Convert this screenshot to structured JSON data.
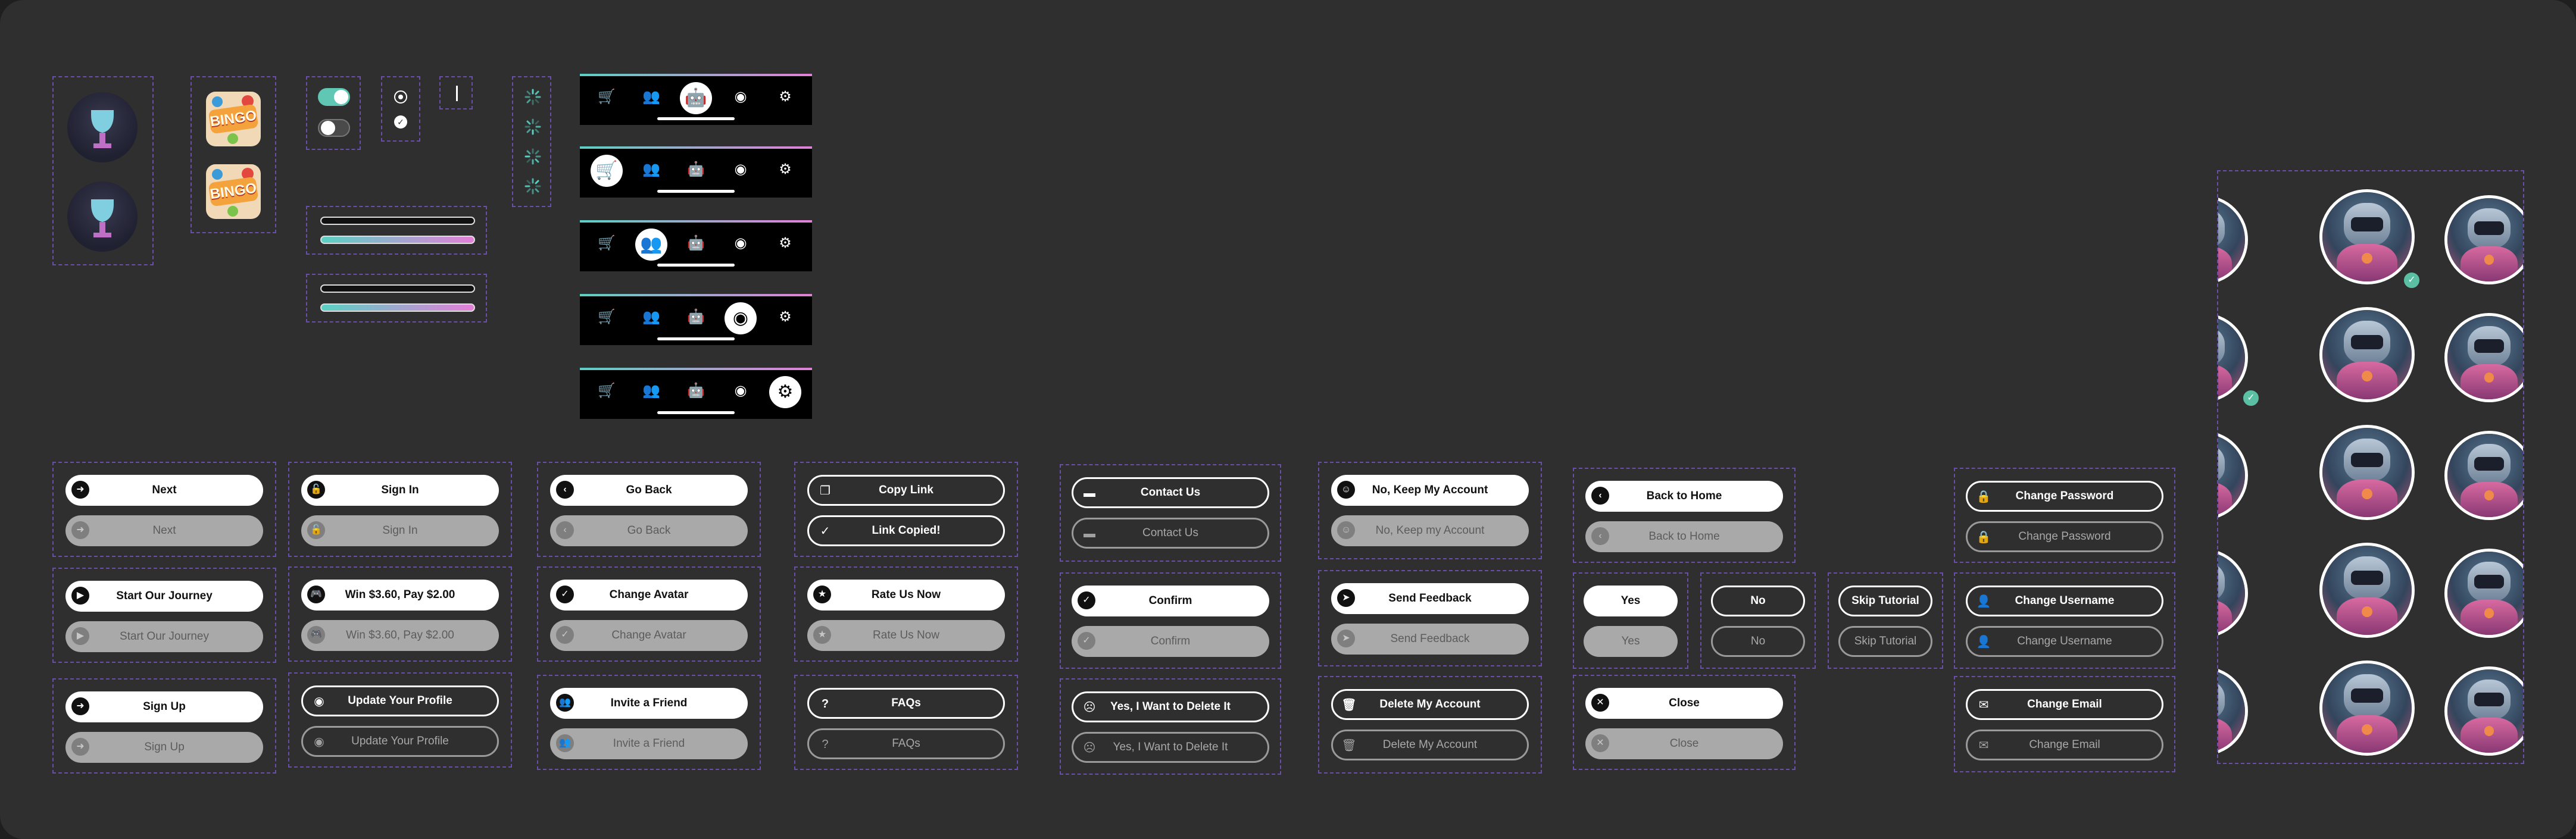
{
  "colors": {
    "background": "#2f2f2f",
    "group_border": "#6a4fa8",
    "accent_teal": "#5ad1c4",
    "accent_pink": "#e47fd8",
    "button_white": "#ffffff",
    "button_disabled": "#a9a9a9"
  },
  "icon_components": {
    "trophies": [
      "trophy-icon",
      "trophy-icon"
    ],
    "bingo_logos": [
      "BINGO",
      "BINGO"
    ],
    "toggles": [
      {
        "state": "on"
      },
      {
        "state": "off"
      }
    ],
    "radios": [
      {
        "state": "unchecked"
      },
      {
        "state": "checked"
      }
    ],
    "progress_bars": [
      {
        "value": 0.0
      },
      {
        "value": 1.0
      },
      {
        "value": 0.0
      },
      {
        "value": 1.0
      }
    ],
    "spinners": [
      "spinner-icon",
      "spinner-icon",
      "spinner-icon",
      "spinner-icon"
    ]
  },
  "navbars": {
    "icons": [
      "cart-icon",
      "friends-icon",
      "robot-icon",
      "profile-icon",
      "settings-icon"
    ],
    "active_indices": [
      2,
      0,
      1,
      3,
      4
    ]
  },
  "buttons": {
    "next": {
      "label": "Next",
      "label_disabled": "Next",
      "icon": "arrow-right-icon"
    },
    "sign_in": {
      "label": "Sign In",
      "label_disabled": "Sign In",
      "icon": "lock-open-icon"
    },
    "go_back": {
      "label": "Go Back",
      "label_disabled": "Go Back",
      "icon": "chevron-left-icon"
    },
    "copy_link": {
      "label": "Copy Link",
      "label_copied": "Link Copied!",
      "icon": "copy-icon",
      "icon_copied": "check-icon"
    },
    "contact_us": {
      "label": "Contact Us",
      "label_disabled": "Contact Us",
      "icon": "message-icon"
    },
    "no_keep_account": {
      "label": "No, Keep My Account",
      "label_disabled": "No, Keep my Account",
      "icon": "smile-icon"
    },
    "back_to_home": {
      "label": "Back to Home",
      "label_disabled": "Back to Home",
      "icon": "chevron-left-icon"
    },
    "change_password": {
      "label": "Change Password",
      "label_disabled": "Change Password",
      "icon": "lock-icon"
    },
    "start_journey": {
      "label": "Start Our Journey",
      "label_disabled": "Start Our Journey",
      "icon": "play-icon"
    },
    "win_pay": {
      "label": "Win $3.60, Pay $2.00",
      "label_disabled": "Win $3.60, Pay $2.00",
      "icon": "gamepad-icon"
    },
    "change_avatar": {
      "label": "Change Avatar",
      "label_disabled": "Change Avatar",
      "icon": "check-icon"
    },
    "rate_us": {
      "label": "Rate Us Now",
      "label_disabled": "Rate Us Now",
      "icon": "star-icon"
    },
    "confirm": {
      "label": "Confirm",
      "label_disabled": "Confirm",
      "icon": "check-icon"
    },
    "send_feedback": {
      "label": "Send Feedback",
      "label_disabled": "Send Feedback",
      "icon": "send-icon"
    },
    "yes": {
      "label": "Yes",
      "label_disabled": "Yes"
    },
    "no": {
      "label": "No",
      "label_disabled": "No"
    },
    "skip_tutorial": {
      "label": "Skip Tutorial",
      "label_disabled": "Skip Tutorial"
    },
    "change_username": {
      "label": "Change Username",
      "label_disabled": "Change Username",
      "icon": "user-icon"
    },
    "sign_up": {
      "label": "Sign Up",
      "label_disabled": "Sign Up",
      "icon": "arrow-right-icon"
    },
    "update_profile": {
      "label": "Update Your Profile",
      "label_disabled": "Update Your Profile",
      "icon": "profile-icon"
    },
    "invite_friend": {
      "label": "Invite a Friend",
      "label_disabled": "Invite a Friend",
      "icon": "add-friend-icon"
    },
    "faqs": {
      "label": "FAQs",
      "label_disabled": "FAQs",
      "icon": "question-icon"
    },
    "delete_yes": {
      "label": "Yes, I Want to Delete It",
      "label_disabled": "Yes, I Want to Delete It",
      "icon": "sad-icon"
    },
    "delete_account": {
      "label": "Delete My Account",
      "label_disabled": "Delete My Account",
      "icon": "trash-icon"
    },
    "close": {
      "label": "Close",
      "label_disabled": "Close",
      "icon": "close-icon"
    },
    "change_email": {
      "label": "Change Email",
      "label_disabled": "Change Email",
      "icon": "mail-icon"
    }
  },
  "avatars": {
    "rows": 5,
    "selected_row": 0,
    "check_icon": "check-icon"
  }
}
